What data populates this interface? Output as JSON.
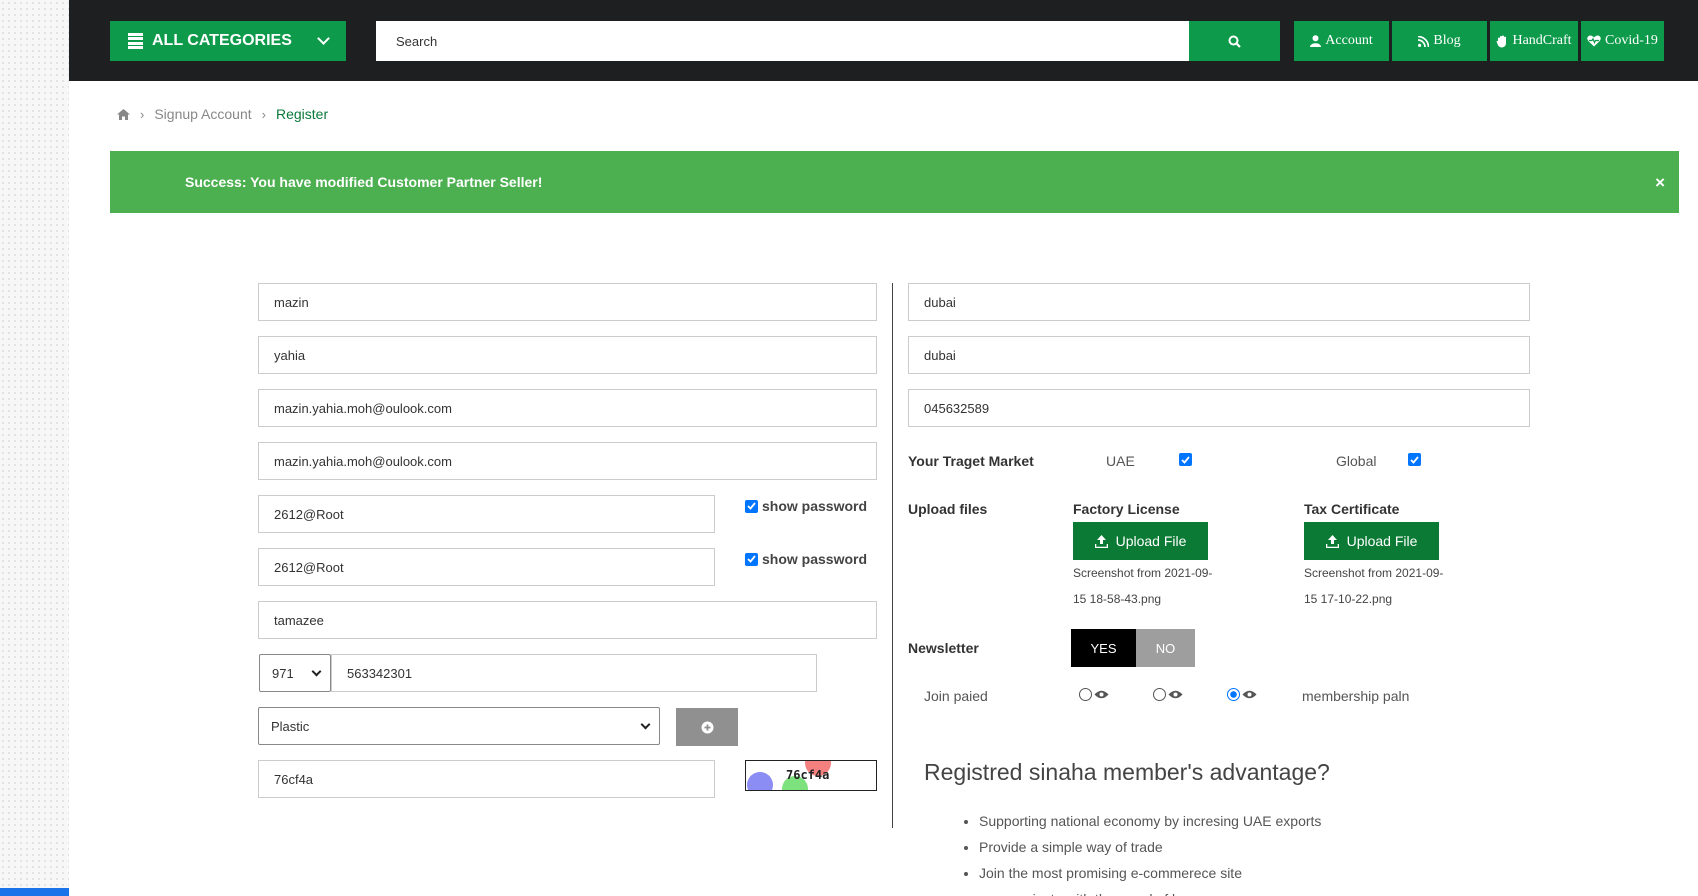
{
  "header": {
    "all_categories": "ALL CATEGORIES",
    "search_placeholder": "Search",
    "nav": [
      {
        "label": "Account",
        "icon": "user-icon"
      },
      {
        "label": "Blog",
        "icon": "rss-icon"
      },
      {
        "label": "HandCraft",
        "icon": "hand-icon"
      },
      {
        "label": "Covid-19",
        "icon": "heartbeat-icon"
      }
    ]
  },
  "breadcrumb": {
    "home_icon": "home-icon",
    "items": [
      "Signup Account",
      "Register"
    ]
  },
  "alert": {
    "message": "Success: You have modified Customer Partner Seller!",
    "close": "×"
  },
  "form_left": {
    "first_name": "mazin",
    "last_name": "yahia",
    "email": "mazin.yahia.moh@oulook.com",
    "email_confirm": "mazin.yahia.moh@oulook.com",
    "password": "2612@Root",
    "password_confirm": "2612@Root",
    "show_password_label": "show password",
    "company": "tamazee",
    "phone_code": "971",
    "phone": "563342301",
    "category": "Plastic",
    "captcha_input": "76cf4a",
    "captcha_text": "76cf4a"
  },
  "form_right": {
    "city": "dubai",
    "region": "dubai",
    "phone2": "045632589",
    "target_market_label": "Your Traget Market",
    "market_uae": "UAE",
    "market_global": "Global",
    "upload_label": "Upload files",
    "factory_license_label": "Factory License",
    "tax_certificate_label": "Tax Certificate",
    "upload_button": "Upload File",
    "factory_file_line1": "Screenshot from 2021-09-",
    "factory_file_line2": "15 18-58-43.png",
    "tax_file_line1": "Screenshot from 2021-09-",
    "tax_file_line2": "15 17-10-22.png",
    "newsletter_label": "Newsletter",
    "newsletter_yes": "YES",
    "newsletter_no": "NO",
    "join_label": "Join paied",
    "membership_label": "membership paln"
  },
  "advantages": {
    "title": "Registred sinaha member's advantage?",
    "items": [
      "Supporting national economy by incresing UAE exports",
      "Provide a simple way of trade",
      "Join the most promising e-commerece site",
      "communicate with thousand of buyers"
    ]
  },
  "colors": {
    "brand_green": "#0e9a4b",
    "alert_green": "#4caf50",
    "topbar": "#1e1f21",
    "upload_green": "#0a7a34"
  }
}
